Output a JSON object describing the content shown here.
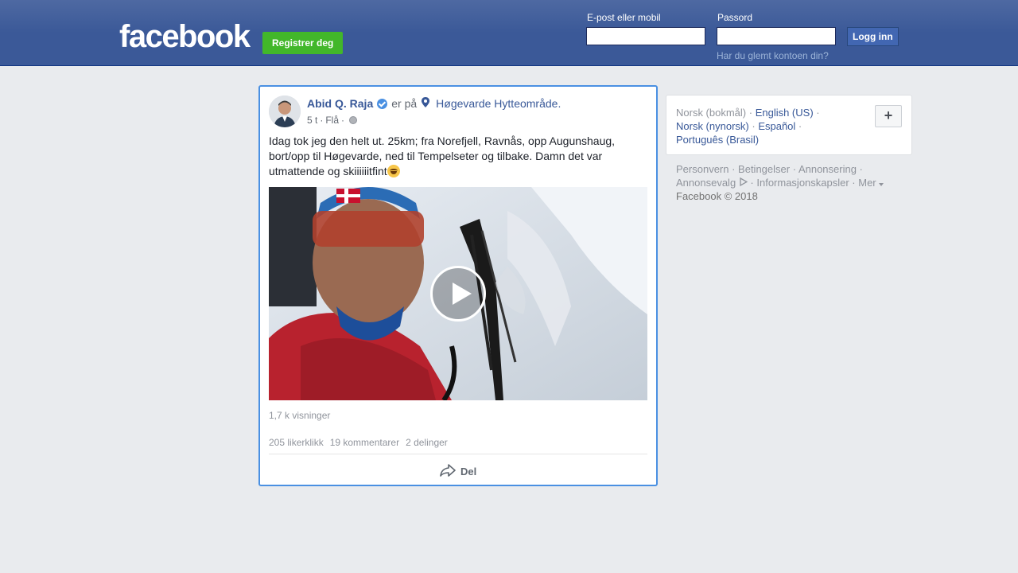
{
  "header": {
    "logo": "facebook",
    "register_label": "Registrer deg",
    "email_label": "E-post eller mobil",
    "password_label": "Passord",
    "login_label": "Logg inn",
    "forgot_label": "Har du glemt kontoen din?"
  },
  "post": {
    "author": "Abid Q. Raja",
    "verb": "er på",
    "location": "Høgevarde Hytteområde.",
    "time": "5 t",
    "place": "Flå",
    "text": "Idag tok jeg den helt ut. 25km; fra Norefjell, Ravnås, opp Augunshaug, bort/opp til Høgevarde, ned til Tempelseter og tilbake. Damn det var utmattende og skiiiiiitfint",
    "views": "1,7 k visninger",
    "likes": "205 likerklikk",
    "comments": "19 kommentarer",
    "shares": "2 delinger",
    "share_label": "Del"
  },
  "languages": {
    "current": "Norsk (bokmål)",
    "options": [
      "English (US)",
      "Norsk (nynorsk)",
      "Español",
      "Português (Brasil)"
    ],
    "more_symbol": "+"
  },
  "footer": {
    "links": [
      "Personvern",
      "Betingelser",
      "Annonsering",
      "Annonsevalg",
      "Informasjonskapsler",
      "Mer"
    ],
    "copyright": "Facebook © 2018"
  }
}
